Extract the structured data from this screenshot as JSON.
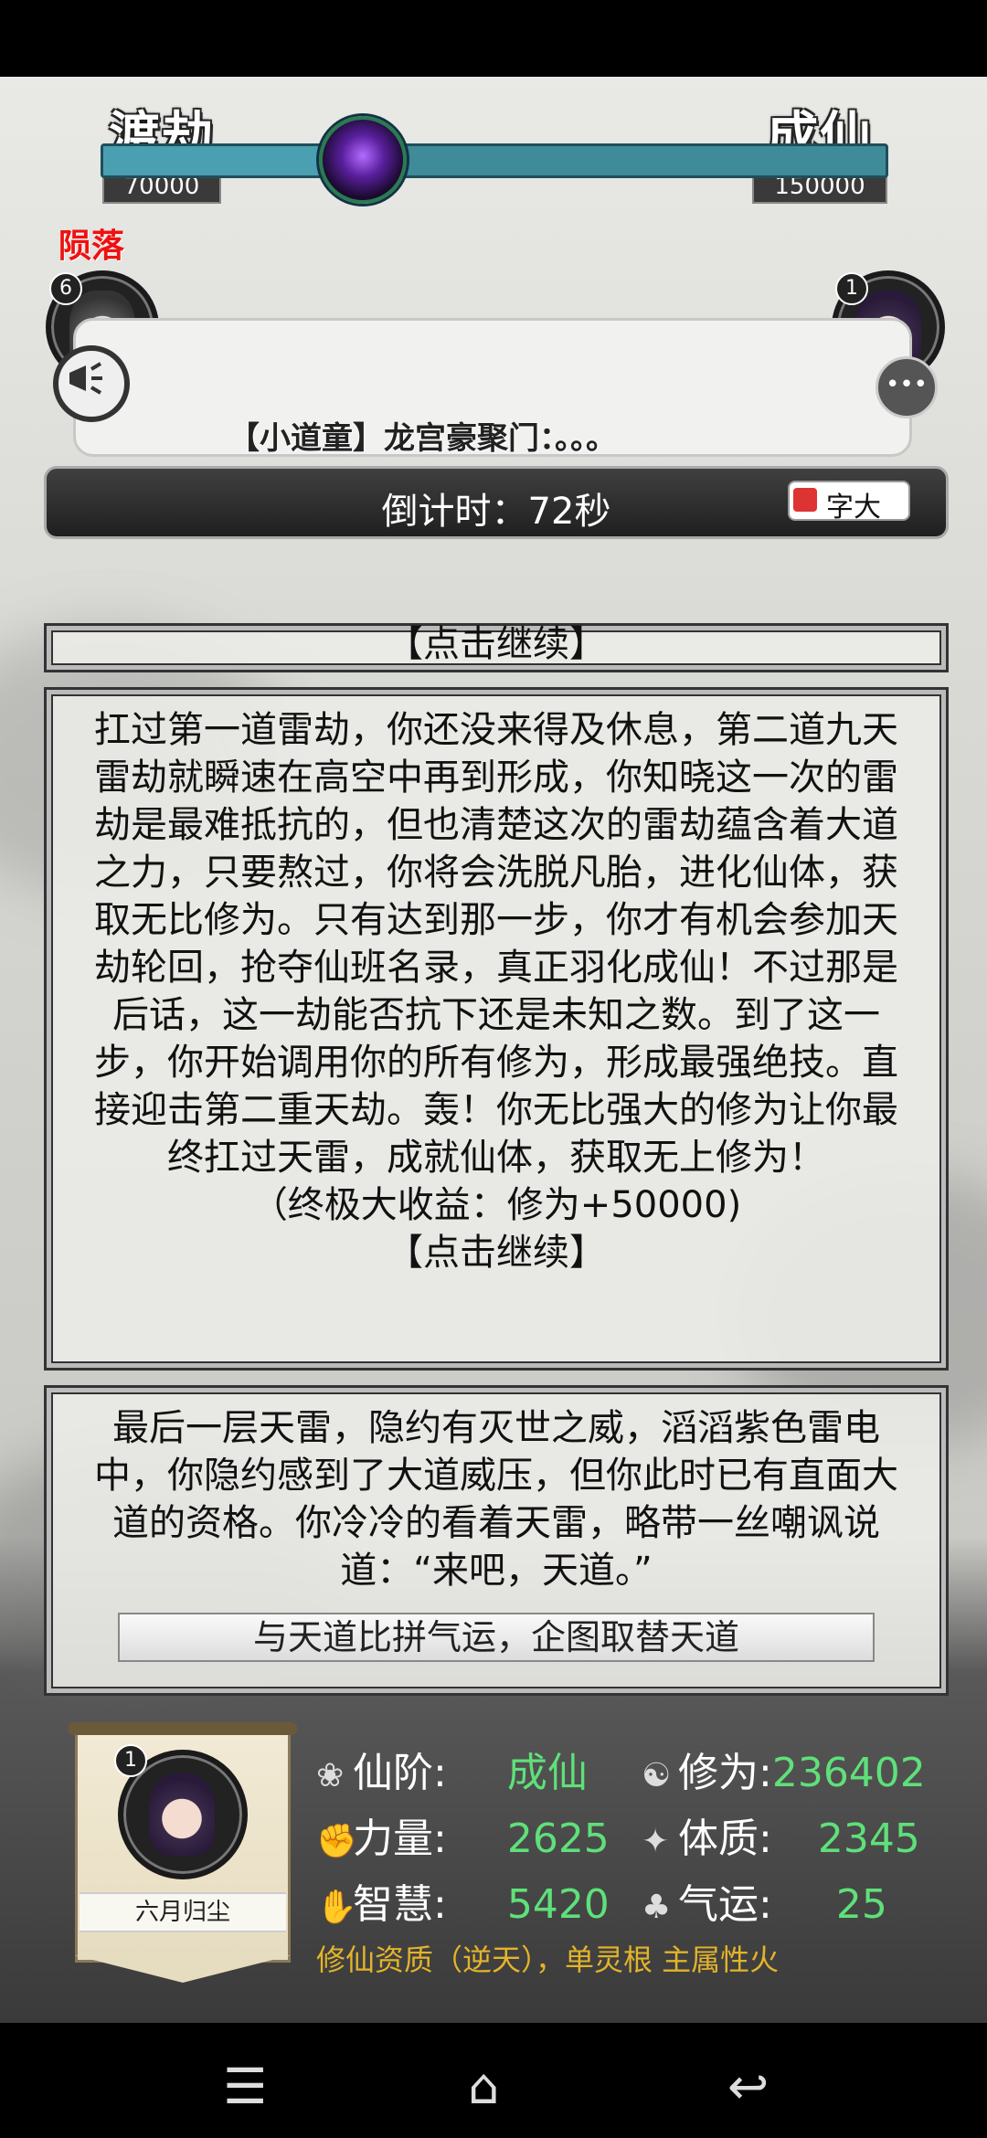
{
  "realm_left": {
    "name": "渡劫",
    "points": "70000"
  },
  "realm_right": {
    "name": "成仙",
    "points": "150000"
  },
  "progress_fraction": 0.28,
  "left_player": {
    "badge": "6",
    "status": "陨落"
  },
  "right_player": {
    "badge": "1"
  },
  "broadcast": "【小道童】龙宫豪聚门：。。。",
  "countdown": "倒计时：72秒",
  "font_toggle_label": "字大",
  "panel_top_continue": "【点击继续】",
  "panel_main": {
    "text": "扛过第一道雷劫，你还没来得及休息，第二道九天雷劫就瞬速在高空中再到形成，你知晓这一次的雷劫是最难抵抗的，但也清楚这次的雷劫蕴含着大道之力，只要熬过，你将会洗脱凡胎，进化仙体，获取无比修为。只有达到那一步，你才有机会参加天劫轮回，抢夺仙班名录，真正羽化成仙！不过那是后话，这一劫能否抗下还是未知之数。到了这一步，你开始调用你的所有修为，形成最强绝技。直接迎击第二重天劫。轰！你无比强大的修为让你最终扛过天雷，成就仙体，获取无上修为！",
    "reward": "（终极大收益：修为+50000)",
    "continue": "【点击继续】"
  },
  "panel_final": {
    "text": "最后一层天雷，隐约有灭世之威，滔滔紫色雷电中，你隐约感到了大道威压，但你此时已有直面大道的资格。你冷冷的看着天雷，略带一丝嘲讽说道：“来吧，天道。”",
    "choice": "与天道比拼气运，企图取替天道"
  },
  "profile": {
    "badge": "1",
    "name": "六月归尘",
    "stats": {
      "rank_label": "仙阶:",
      "rank_value": "成仙",
      "cultivation_label": "修为:",
      "cultivation_value": "236402",
      "strength_label": "力量:",
      "strength_value": "2625",
      "constitution_label": "体质:",
      "constitution_value": "2345",
      "wisdom_label": "智慧:",
      "wisdom_value": "5420",
      "luck_label": "气运:",
      "luck_value": "25"
    },
    "aptitude": "修仙资质（逆天），单灵根 主属性火"
  },
  "nav": {
    "menu": "☰",
    "home": "⌂",
    "back": "↩"
  },
  "icons": [
    "vortex-orb-icon",
    "megaphone-icon",
    "chat-bubble-icon",
    "lotus-icon",
    "yin-yang-icon",
    "fist-icon",
    "body-icon",
    "wisdom-hand-icon",
    "clover-icon"
  ]
}
